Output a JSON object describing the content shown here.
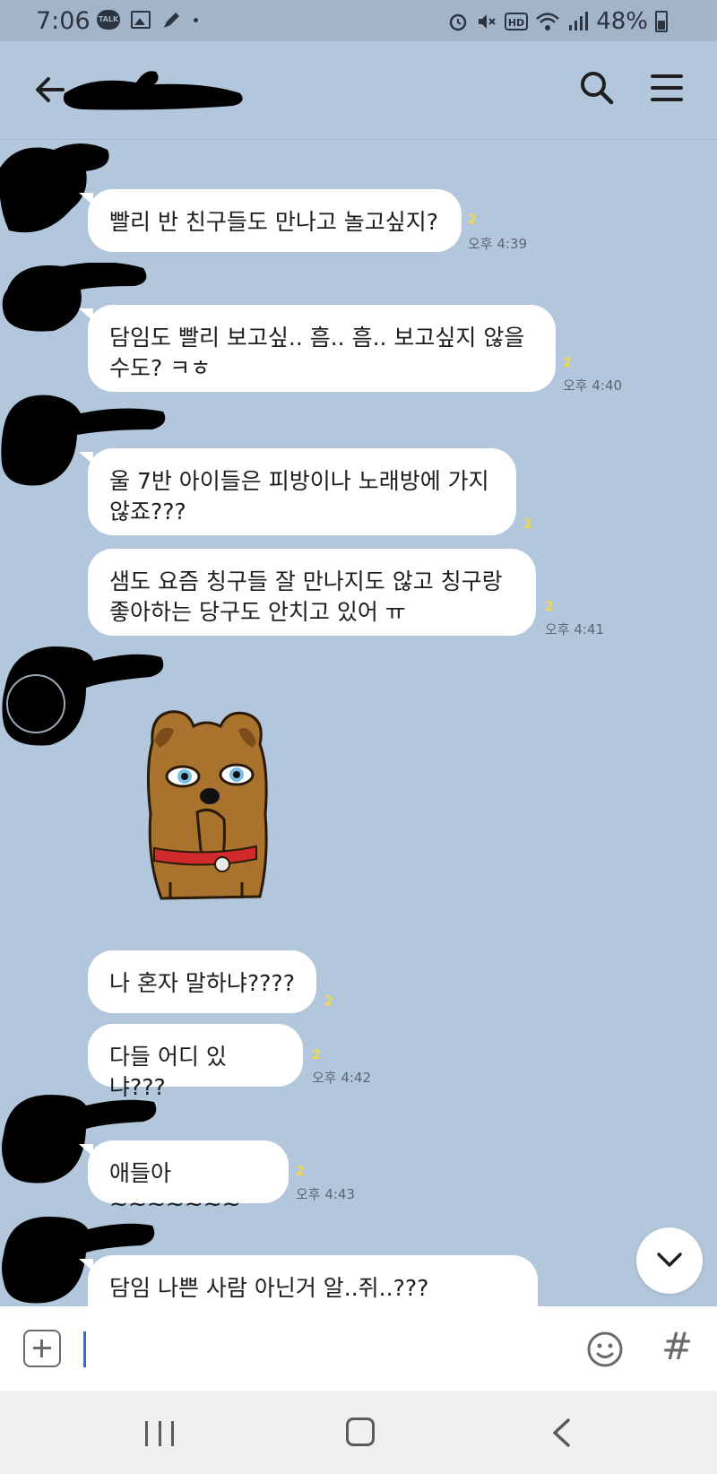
{
  "status_bar": {
    "time": "7:06",
    "talk_badge": "TALK",
    "battery": "48%"
  },
  "header": {
    "title": ""
  },
  "messages": [
    {
      "text": "빨리 반 친구들도 만나고 놀고싶지?",
      "unread": "2",
      "time": "오후 4:39"
    },
    {
      "text": "담임도 빨리 보고싶.. 흠.. 흠.. 보고싶지 않을 수도? ㅋㅎ",
      "unread": "2",
      "time": "오후 4:40"
    },
    {
      "text": "울 7반 아이들은 피방이나 노래방에 가지 않죠???",
      "unread": "2",
      "time": ""
    },
    {
      "text": "샘도 요즘 칭구들 잘 만나지도 않고  칭구랑 좋아하는 당구도 안치고 있어 ㅠ",
      "unread": "2",
      "time": "오후 4:41"
    },
    {
      "text": "나 혼자 말하냐????",
      "unread": "2",
      "time": ""
    },
    {
      "text": "다들 어디 있냐???",
      "unread": "2",
      "time": "오후 4:42"
    },
    {
      "text": "애들아~~~~~~~",
      "unread": "2",
      "time": "오후 4:43"
    },
    {
      "text": "담임 나쁜 사람 아닌거 알..쥐..???~~~~~",
      "unread": "",
      "time": ""
    }
  ],
  "input": {
    "placeholder": ""
  },
  "icons": {
    "back": "arrow-left-icon",
    "search": "search-icon",
    "menu": "hamburger-menu-icon",
    "plus": "plus-square-icon",
    "emoji": "smiley-icon",
    "hash": "#",
    "scroll": "chevron-down-icon"
  },
  "colors": {
    "chat_background": "#b3c7dc",
    "bubble": "#ffffff",
    "unread_count": "#f3d743",
    "caret": "#2a6fd8"
  }
}
